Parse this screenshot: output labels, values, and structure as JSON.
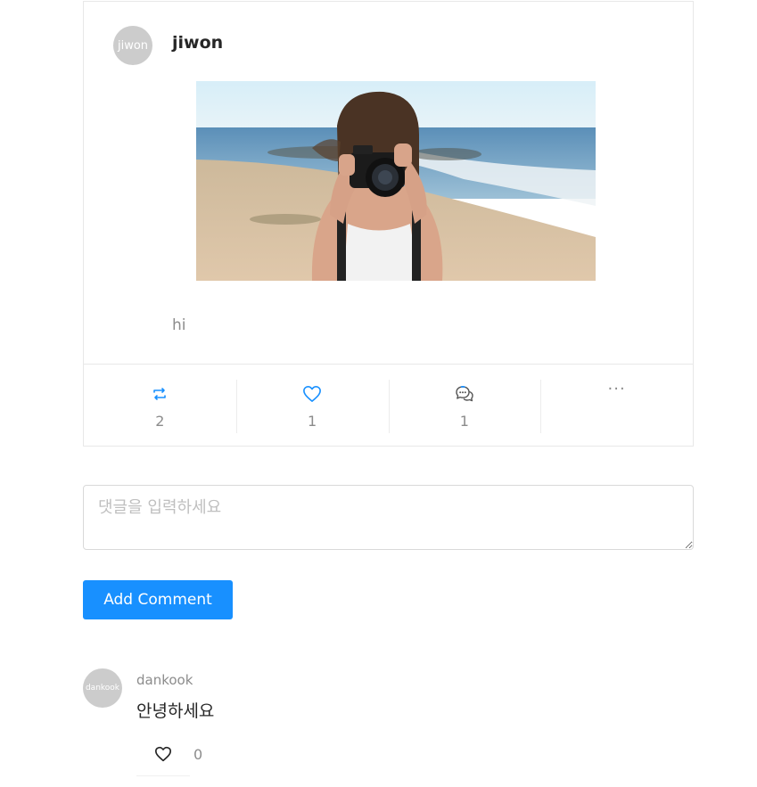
{
  "post": {
    "avatar_text": "jiwon",
    "author": "jiwon",
    "image": "photo of a woman holding a camera on a beach",
    "text": "hi",
    "actions": {
      "retweet_icon": "retweet-icon",
      "retweet_count": "2",
      "like_icon": "heart-outline-icon",
      "like_count": "1",
      "comment_icon": "comment-bubble-icon",
      "comment_count": "1",
      "more_icon": "ellipsis-icon",
      "more_label": "···"
    }
  },
  "comment_form": {
    "placeholder": "댓글을 입력하세요",
    "value": "",
    "submit_label": "Add Comment"
  },
  "comments": [
    {
      "avatar_text": "dankook",
      "author": "dankook",
      "text": "안녕하세요",
      "like_icon": "heart-outline-icon",
      "like_count": "0"
    }
  ],
  "colors": {
    "accent": "#1890ff",
    "avatar_bg": "#cccccc",
    "muted_text": "#8c8c8c",
    "border": "#e8e8e8"
  }
}
